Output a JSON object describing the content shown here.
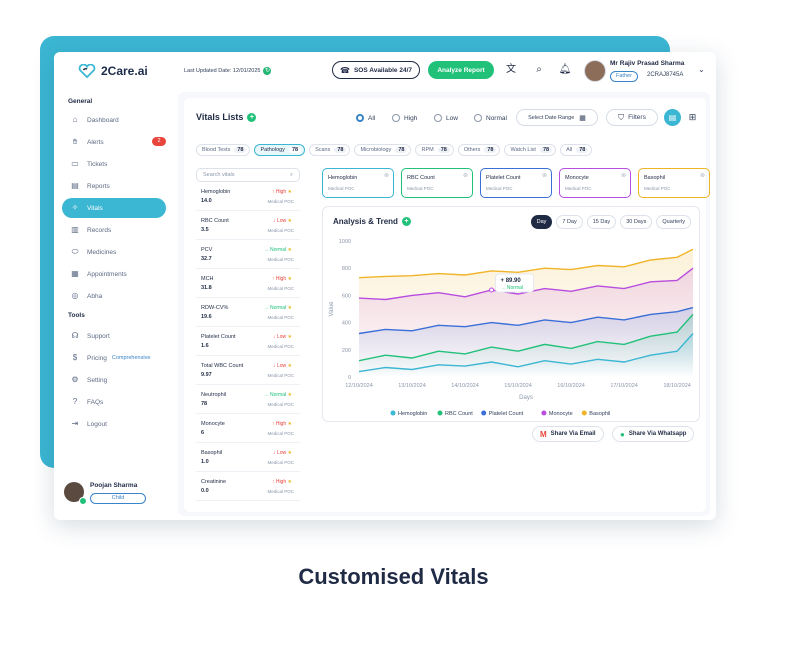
{
  "topbar": {
    "brand": "2Care.ai",
    "last_updated": "Last Updated Date: 12/01/2025",
    "sos_label": "SOS Available 24/7",
    "analyze_label": "Analyze Report",
    "user_name": "Mr Rajiv Prasad Sharma",
    "user_relation": "Father",
    "user_id": "2CRAJ8745A"
  },
  "sidebar": {
    "general_heading": "General",
    "tools_heading": "Tools",
    "general_items": [
      {
        "label": "Dashboard",
        "icon": "home-icon"
      },
      {
        "label": "Alerts",
        "icon": "hand-icon",
        "badge": "2"
      },
      {
        "label": "Tickets",
        "icon": "ticket-icon"
      },
      {
        "label": "Reports",
        "icon": "report-icon"
      },
      {
        "label": "Vitals",
        "icon": "vitals-icon",
        "active": true
      },
      {
        "label": "Records",
        "icon": "records-icon"
      },
      {
        "label": "Medicines",
        "icon": "pill-icon"
      },
      {
        "label": "Appointments",
        "icon": "appointment-icon"
      },
      {
        "label": "Abha",
        "icon": "abha-icon"
      }
    ],
    "tools_items": [
      {
        "label": "Support",
        "icon": "headset-icon"
      },
      {
        "label": "Pricing",
        "extra": "Comprehensive",
        "icon": "dollar-icon"
      },
      {
        "label": "Setting",
        "icon": "settings-icon"
      },
      {
        "label": "FAQs",
        "icon": "faq-icon"
      },
      {
        "label": "Logout",
        "icon": "logout-icon"
      }
    ],
    "user": {
      "name": "Poojan Sharma",
      "role": "Child"
    }
  },
  "vitals": {
    "title": "Vitals Lists",
    "filters": [
      {
        "label": "All",
        "selected": true
      },
      {
        "label": "High",
        "selected": false
      },
      {
        "label": "Low",
        "selected": false
      },
      {
        "label": "Normal",
        "selected": false
      }
    ],
    "date_range_label": "Select Date Range",
    "filters_label": "Filters",
    "categories": [
      {
        "label": "Blood Tests",
        "count": "78"
      },
      {
        "label": "Pathology",
        "count": "78",
        "active": true
      },
      {
        "label": "Scans",
        "count": "78"
      },
      {
        "label": "Microbiology",
        "count": "78"
      },
      {
        "label": "RPM",
        "count": "78"
      },
      {
        "label": "Others",
        "count": "78"
      },
      {
        "label": "Watch List",
        "count": "78"
      },
      {
        "label": "All",
        "count": "78"
      }
    ],
    "search_placeholder": "Search vitals",
    "list": [
      {
        "name": "Hemoglobin",
        "value": "14.0",
        "status": "High",
        "source": "Medical POC"
      },
      {
        "name": "RBC Count",
        "value": "3.5",
        "status": "Low",
        "source": "Medical POC"
      },
      {
        "name": "PCV",
        "value": "32.7",
        "status": "Normal",
        "source": "Medical POC"
      },
      {
        "name": "MCH",
        "value": "31.8",
        "status": "High",
        "source": "Medical POC"
      },
      {
        "name": "RDW-CV%",
        "value": "19.6",
        "status": "Normal",
        "source": "Medical POC"
      },
      {
        "name": "Platelet Count",
        "value": "1.6",
        "status": "Low",
        "source": "Medical POC"
      },
      {
        "name": "Total WBC Count",
        "value": "9.97",
        "status": "Low",
        "source": "Medical POC"
      },
      {
        "name": "Neutrophil",
        "value": "78",
        "status": "Normal",
        "source": "Medical POC"
      },
      {
        "name": "Monocyte",
        "value": "6",
        "status": "High",
        "source": "Medical POC"
      },
      {
        "name": "Basophil",
        "value": "1.0",
        "status": "Low",
        "source": "Medical POC"
      },
      {
        "name": "Creatinine",
        "value": "0.0",
        "status": "High",
        "source": "Medical POC"
      }
    ],
    "cards": [
      {
        "name": "Hemoglobin",
        "source": "Medical POC",
        "color": "#3bb6d3"
      },
      {
        "name": "RBC Count",
        "source": "Medical POC",
        "color": "#22c17a"
      },
      {
        "name": "Platelet Count",
        "source": "Medical POC",
        "color": "#3a6fd8"
      },
      {
        "name": "Monocyte",
        "source": "Medical POC",
        "color": "#b84de0"
      },
      {
        "name": "Basophil",
        "source": "Medical POC",
        "color": "#f0b429"
      }
    ],
    "status_colors": {
      "High": "#e8453c",
      "Low": "#e8453c",
      "Normal": "#22c17a"
    }
  },
  "chart_section": {
    "title": "Analysis & Trend",
    "ranges": [
      {
        "label": "Day",
        "active": true
      },
      {
        "label": "7 Day"
      },
      {
        "label": "15 Day"
      },
      {
        "label": "30 Days"
      },
      {
        "label": "Quarterly"
      }
    ],
    "tooltip_value": "+ 89.90",
    "tooltip_status": "Normal",
    "share_email": "Share Via Email",
    "share_whatsapp": "Share Via Whatsapp"
  },
  "chart_data": {
    "type": "area",
    "xlabel": "Days",
    "ylabel": "Value",
    "ylim": [
      0,
      1000
    ],
    "yticks": [
      0,
      200,
      400,
      600,
      800,
      1000
    ],
    "xtick_labels": [
      "12/10/2024",
      "13/10/2024",
      "14/10/2024",
      "15/10/2024",
      "16/10/2024",
      "17/10/2024",
      "18/10/2024"
    ],
    "x": [
      0,
      0.5,
      1,
      1.5,
      2,
      2.5,
      3,
      3.5,
      4,
      4.5,
      5,
      5.5,
      6,
      6.3
    ],
    "legend_position": "bottom",
    "series": [
      {
        "name": "Hemoglobin",
        "color": "#3bb6d3",
        "values": [
          40,
          70,
          55,
          90,
          80,
          110,
          75,
          120,
          95,
          130,
          110,
          160,
          190,
          320
        ]
      },
      {
        "name": "RBC Count",
        "color": "#22c17a",
        "values": [
          120,
          160,
          140,
          190,
          170,
          220,
          190,
          240,
          210,
          260,
          240,
          300,
          330,
          460
        ]
      },
      {
        "name": "Platelet Count",
        "color": "#3a6fd8",
        "values": [
          320,
          350,
          340,
          380,
          370,
          400,
          380,
          420,
          400,
          440,
          420,
          460,
          480,
          510
        ]
      },
      {
        "name": "Monocyte",
        "color": "#b84de0",
        "values": [
          580,
          570,
          600,
          620,
          590,
          640,
          610,
          650,
          630,
          670,
          650,
          700,
          710,
          800
        ]
      },
      {
        "name": "Basophil",
        "color": "#f0b429",
        "values": [
          730,
          740,
          745,
          760,
          750,
          780,
          770,
          800,
          790,
          820,
          810,
          860,
          880,
          940
        ]
      }
    ]
  },
  "caption": "Customised Vitals"
}
